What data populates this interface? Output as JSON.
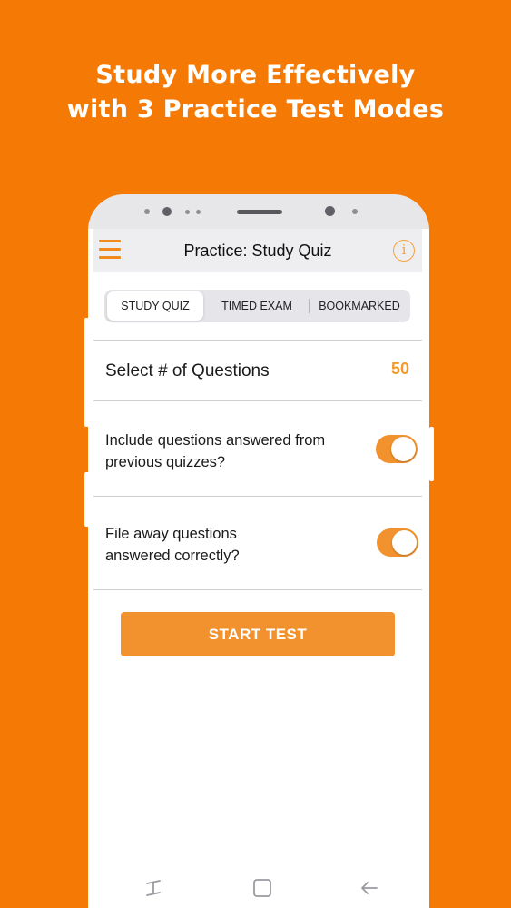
{
  "promo": {
    "line1": "Study More Effectively",
    "line2": "with 3 Practice Test Modes"
  },
  "header": {
    "title": "Practice: Study Quiz",
    "info_glyph": "i",
    "menu_icon": "hamburger-menu-icon",
    "info_icon": "info-circle-icon"
  },
  "tabs": [
    {
      "label": "STUDY QUIZ",
      "active": true
    },
    {
      "label": "TIMED EXAM",
      "active": false
    },
    {
      "label": "BOOKMARKED",
      "active": false
    }
  ],
  "question_count": {
    "label": "Select # of Questions",
    "value": "50"
  },
  "options": [
    {
      "label_line1": "Include questions answered from",
      "label_line2": "previous quizzes?",
      "on": true
    },
    {
      "label_line1": "File away questions",
      "label_line2": "answered correctly?",
      "on": true
    }
  ],
  "start_button": {
    "label": "START TEST"
  },
  "nav_bar": {
    "icons": [
      "recent-apps-icon",
      "home-icon",
      "back-icon"
    ]
  },
  "colors": {
    "background": "#F57A05",
    "accent": "#F2922E",
    "value_text": "#F29A2C"
  }
}
